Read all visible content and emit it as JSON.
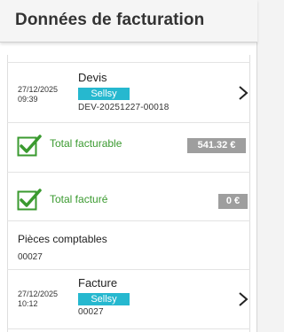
{
  "header": {
    "title": "Données de facturation"
  },
  "devis": {
    "date": "27/12/2025",
    "time": "09:39",
    "title": "Devis",
    "badge": "Sellsy",
    "reference": "DEV-20251227-00018"
  },
  "total_facturable": {
    "label": "Total facturable",
    "amount": "541.32 €"
  },
  "total_facture": {
    "label": "Total facturé",
    "amount": "0 €"
  },
  "pieces_comptables": {
    "title": "Pièces comptables",
    "number": "00027"
  },
  "facture": {
    "date": "27/12/2025",
    "time": "10:12",
    "title": "Facture",
    "badge": "Sellsy",
    "reference": "00027"
  },
  "colors": {
    "badge": "#26b8cf",
    "success": "#3a9a2f",
    "amount_bg": "#9e9e9e"
  },
  "icons": {
    "row_action": "chevron-right-icon",
    "status": "checkbox-checked-icon"
  }
}
